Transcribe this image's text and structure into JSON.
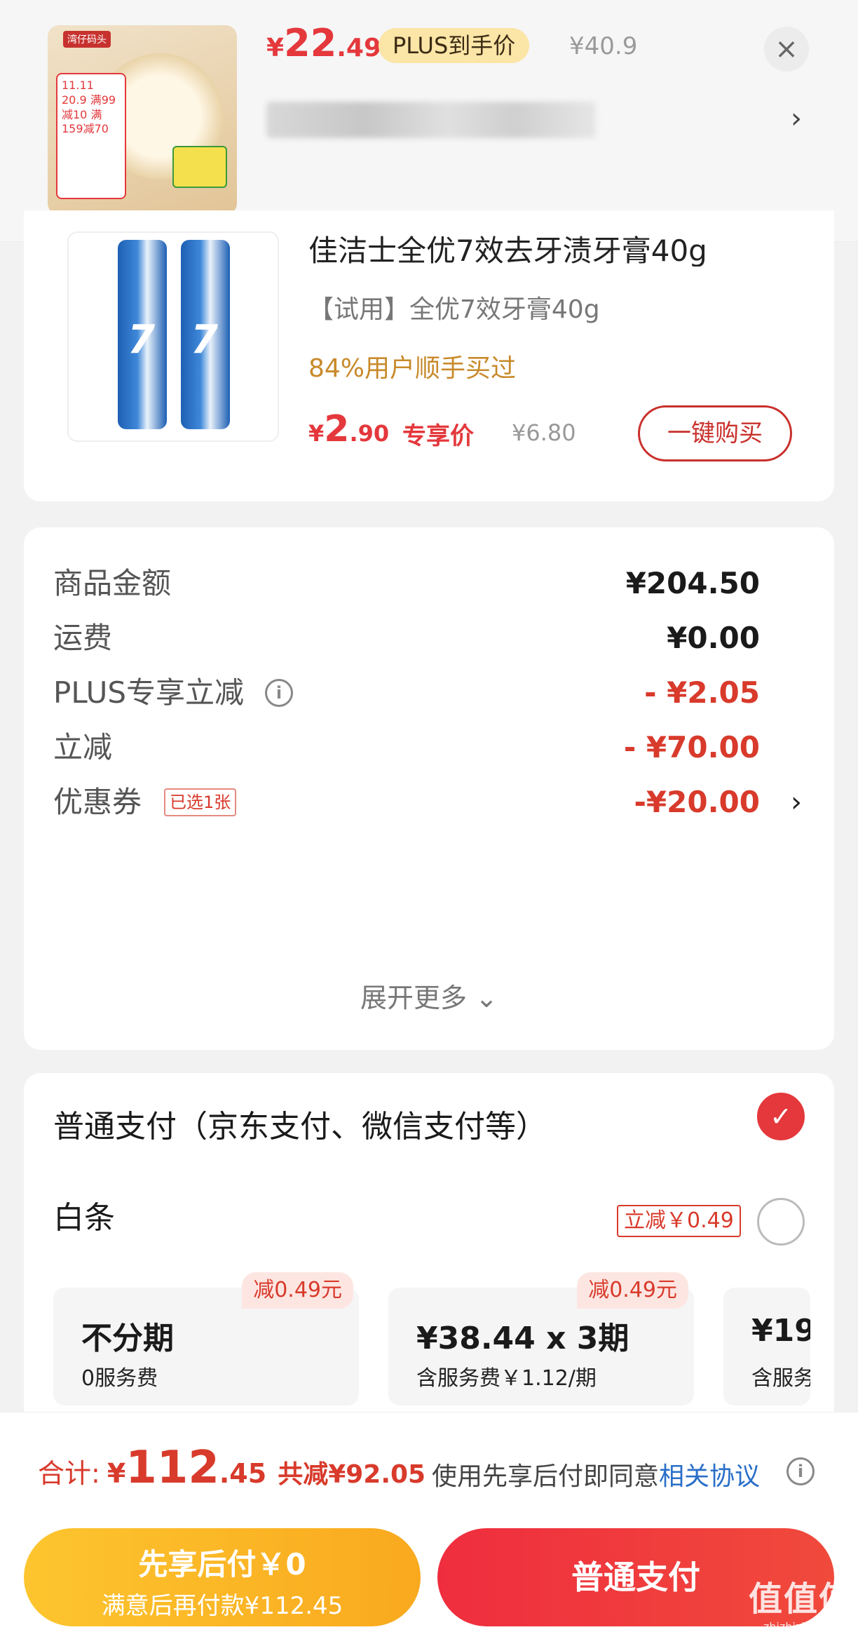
{
  "header": {
    "price_yen": "¥",
    "price_int": "22",
    "price_dec": ".49",
    "plus_badge": "PLUS到手价",
    "original_price": "¥40.9",
    "close_icon": "close-icon",
    "chevron": "›",
    "thumb_brand": "湾仔码头",
    "thumb_promo": "11.11 20.9 满99减10 满159减70"
  },
  "product": {
    "title": "佳洁士全优7效去牙渍牙膏40g",
    "sku": "【试用】全优7效牙膏40g",
    "hint": "84%用户顺手买过",
    "price_yen": "¥",
    "price_int": "2",
    "price_dec": ".90",
    "exclusive_label": "专享价",
    "original_price": "¥6.80",
    "buy_button": "一键购买"
  },
  "summary": {
    "rows": [
      {
        "label": "商品金额",
        "value": "¥204.50"
      },
      {
        "label": "运费",
        "value": "¥0.00"
      },
      {
        "label": "PLUS专享立减",
        "value": "- ¥2.05"
      },
      {
        "label": "立减",
        "value": "- ¥70.00"
      },
      {
        "label": "优惠券",
        "value": "-¥20.00",
        "tag": "已选1张"
      }
    ],
    "expand_more": "展开更多 ⌄"
  },
  "payment": {
    "normal_label": "普通支付（京东支付、微信支付等）",
    "baitiao_label": "白条",
    "baitiao_tag": "立减￥0.49",
    "installments": [
      {
        "main": "不分期",
        "sub": "0服务费",
        "discount": "减0.49元"
      },
      {
        "main": "¥38.44 x 3期",
        "sub": "含服务费￥1.12/期",
        "discount": "减0.49元"
      },
      {
        "main": "¥19",
        "sub": "含服务"
      }
    ]
  },
  "bottom": {
    "total_label": "合计:",
    "total_yen": "¥",
    "total_int": "112",
    "total_dec": ".45",
    "saved": "共减¥92.05",
    "agree_prefix": "使用先享后付即同意",
    "agree_link": "相关协议",
    "pay_later_title": "先享后付￥0",
    "pay_later_sub": "满意后再付款¥112.45",
    "pay_normal": "普通支付"
  },
  "watermark": {
    "text": "值值值",
    "domain": "zhizhizhi.com"
  },
  "colors": {
    "accent_red": "#e4383c",
    "price_red": "#d83a2b",
    "gold": "#f9a91e",
    "link_blue": "#2a6fc9"
  }
}
